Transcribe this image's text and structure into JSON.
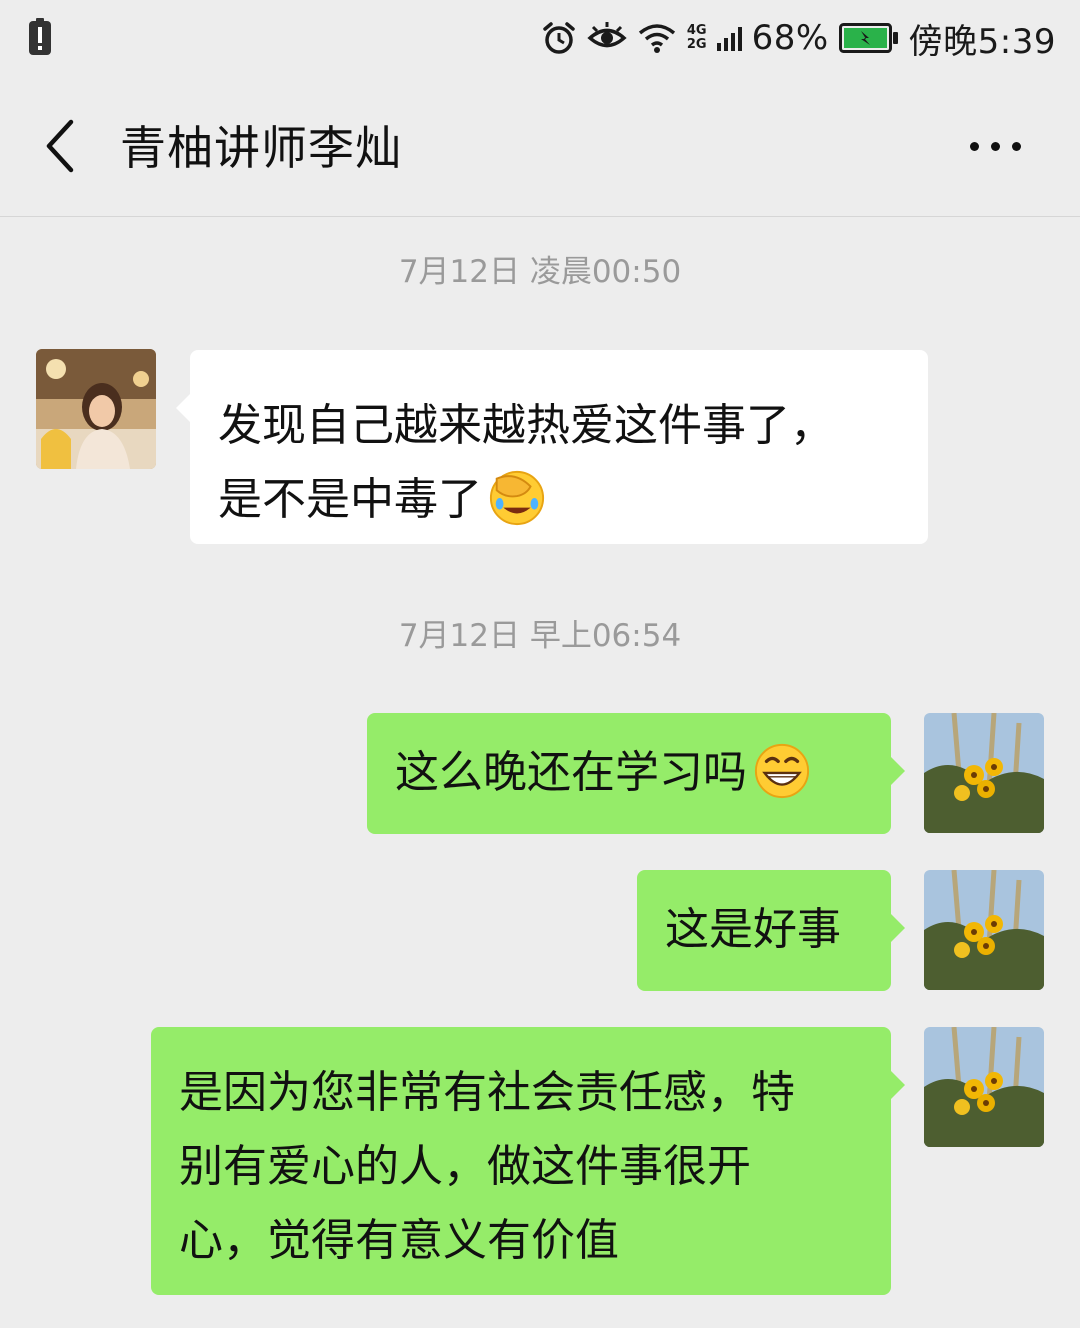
{
  "status_bar": {
    "battery_percent": "68%",
    "time": "傍晚5:39",
    "network_top": "4G",
    "network_bottom": "2G",
    "icons": [
      "alert-icon",
      "alarm-icon",
      "eye-icon",
      "wifi-icon",
      "signal-icon",
      "battery-charging-icon"
    ]
  },
  "header": {
    "title": "青柚讲师李灿",
    "back_icon": "chevron-left-icon",
    "more_icon": "more-dots-icon"
  },
  "timestamps": [
    "7月12日 凌晨00:50",
    "7月12日 早上06:54"
  ],
  "messages": [
    {
      "direction": "incoming",
      "lines": [
        "发现自己越来越热爱这件事了，",
        "是不是中毒了"
      ],
      "emoji": "facepalm-laughing-emoji"
    },
    {
      "direction": "outgoing",
      "lines": [
        "这么晚还在学习吗"
      ],
      "emoji": "grinning-emoji"
    },
    {
      "direction": "outgoing",
      "lines": [
        "这是好事"
      ]
    },
    {
      "direction": "outgoing",
      "lines": [
        "是因为您非常有社会责任感，特",
        "别有爱心的人，做这件事很开",
        "心，觉得有意义有价值"
      ]
    }
  ],
  "colors": {
    "background": "#ededed",
    "incoming_bubble": "#ffffff",
    "outgoing_bubble": "#95ec69",
    "timestamp_text": "#9a9a9a"
  }
}
